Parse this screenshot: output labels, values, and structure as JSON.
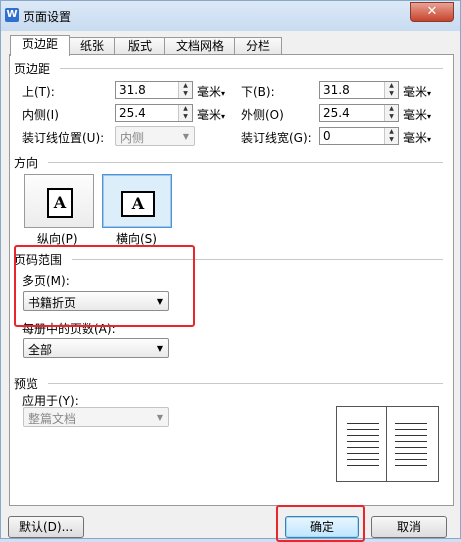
{
  "window": {
    "title": "页面设置",
    "app_icon_glyph": "W",
    "close_glyph": "✕"
  },
  "tabs": [
    {
      "label": "页边距",
      "active": true
    },
    {
      "label": "纸张"
    },
    {
      "label": "版式"
    },
    {
      "label": "文档网格"
    },
    {
      "label": "分栏"
    }
  ],
  "margins": {
    "section_title": "页边距",
    "top": {
      "label": "上(T):",
      "value": "31.8",
      "unit": "毫米"
    },
    "bottom": {
      "label": "下(B):",
      "value": "31.8",
      "unit": "毫米"
    },
    "inside": {
      "label": "内侧(I)",
      "value": "25.4",
      "unit": "毫米"
    },
    "outside": {
      "label": "外侧(O)",
      "value": "25.4",
      "unit": "毫米"
    },
    "gutter_position": {
      "label": "装订线位置(U):",
      "value": "内侧"
    },
    "gutter_width": {
      "label": "装订线宽(G):",
      "value": "0",
      "unit": "毫米"
    }
  },
  "orientation": {
    "section_title": "方向",
    "portrait": {
      "label": "纵向(P)",
      "glyph": "A"
    },
    "landscape": {
      "label": "横向(S)",
      "glyph": "A",
      "selected": true
    }
  },
  "page_range": {
    "section_title": "页码范围",
    "multiple_pages": {
      "label": "多页(M):",
      "value": "书籍折页"
    },
    "sheets_per_booklet": {
      "label": "每册中的页数(A):",
      "value": "全部"
    }
  },
  "preview": {
    "section_title": "预览",
    "apply_to": {
      "label": "应用于(Y):",
      "value": "整篇文档"
    }
  },
  "buttons": {
    "default": "默认(D)...",
    "ok": "确定",
    "cancel": "取消"
  },
  "colors": {
    "highlight": "#e8262b",
    "selected_border": "#4f93d6"
  },
  "icons": {
    "spin": "spin-arrows-icon",
    "dropdown": "chevron-down-icon"
  }
}
